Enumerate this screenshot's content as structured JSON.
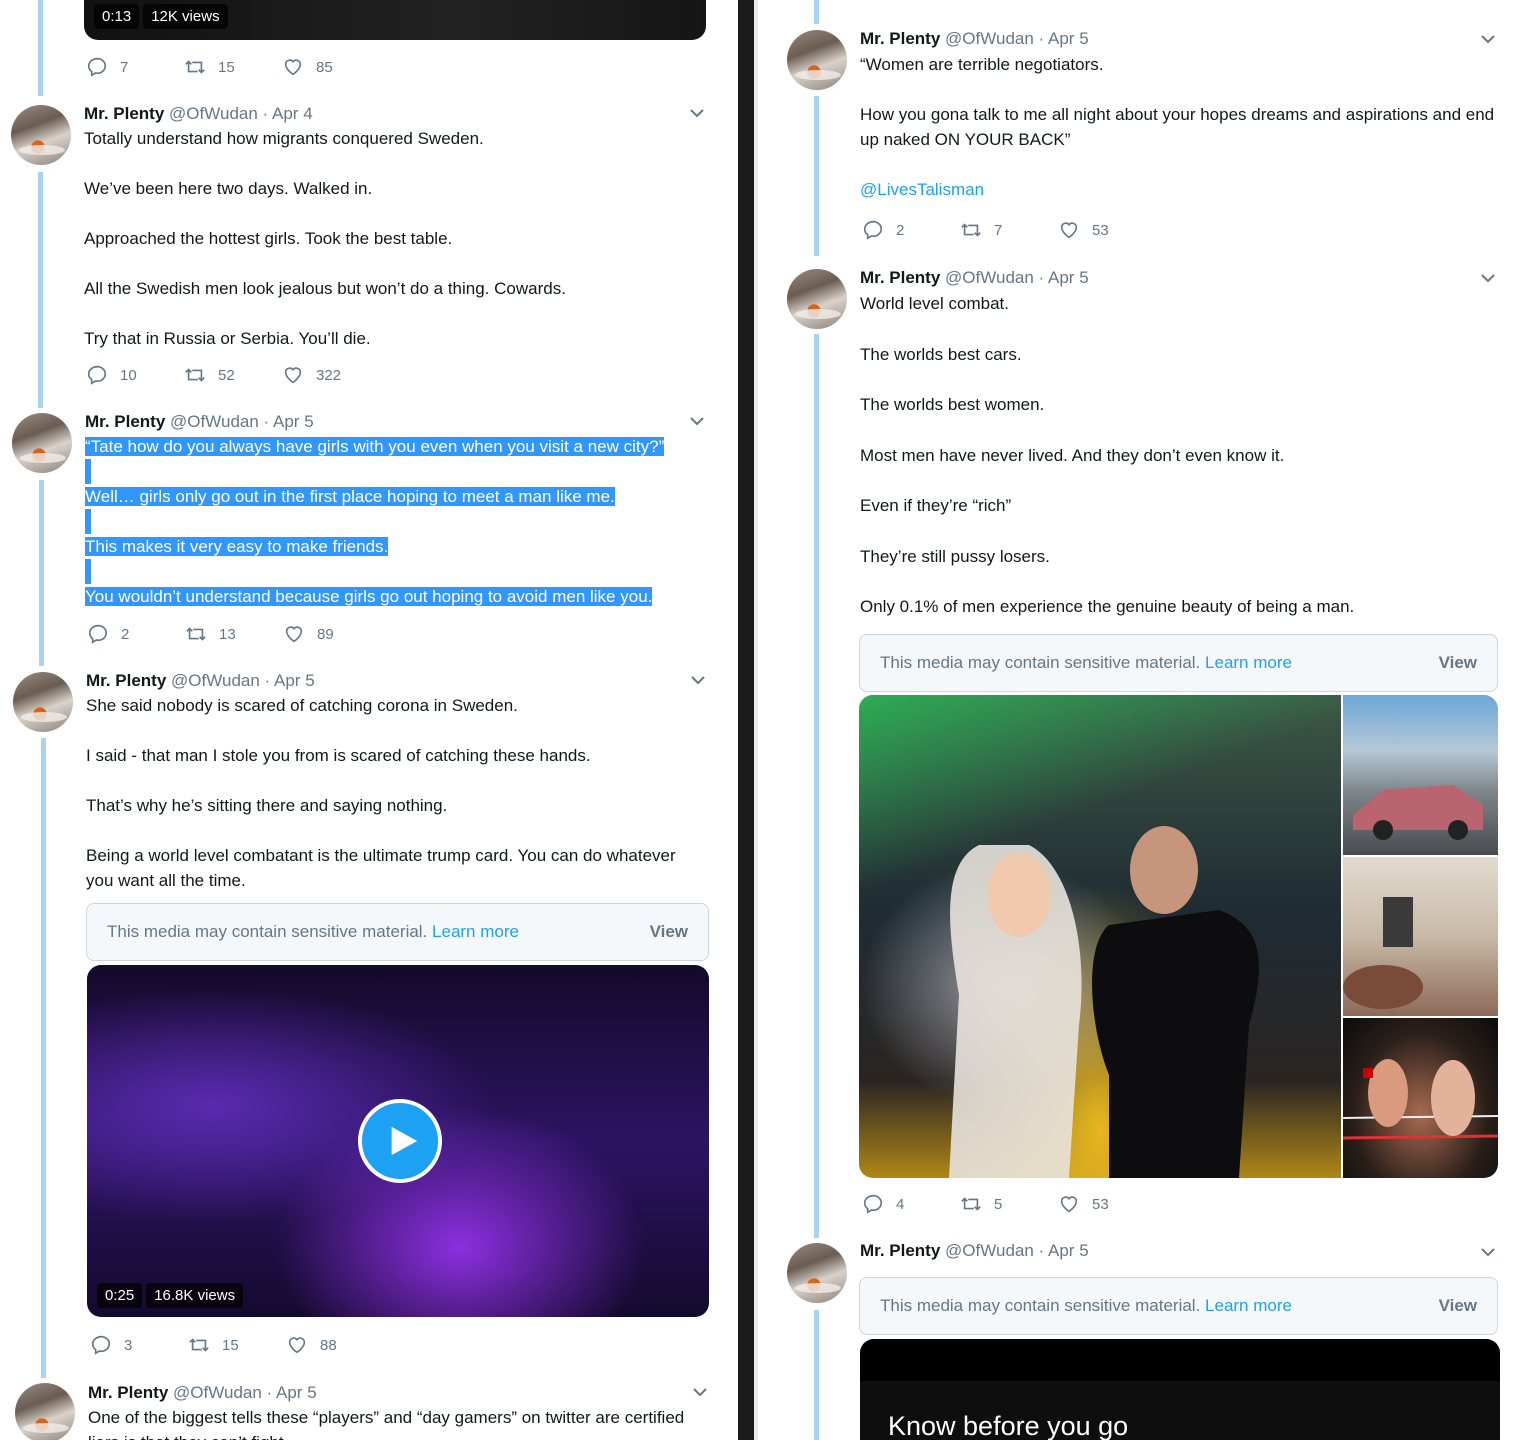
{
  "left": {
    "top_video": {
      "duration": "0:13",
      "views": "12K views"
    },
    "top_actions": {
      "replies": "7",
      "retweets": "15",
      "likes": "85"
    },
    "tweets": [
      {
        "name": "Mr. Plenty",
        "handle": "@OfWudan",
        "sep": "·",
        "date": "Apr 4",
        "lines": [
          "Totally understand how migrants conquered Sweden.",
          "We’ve been here two days. Walked in.",
          "Approached the hottest girls. Took the best table.",
          "All the Swedish men look jealous but won’t do a thing. Cowards.",
          "Try that in Russia or Serbia. You’ll die."
        ],
        "replies": "10",
        "retweets": "52",
        "likes": "322"
      },
      {
        "name": "Mr. Plenty",
        "handle": "@OfWudan",
        "sep": "·",
        "date": "Apr 5",
        "lines": [
          "“Tate how do you always have girls with you even when you visit a new city?”",
          "Well… girls only go out in the first place hoping to meet a man like me.",
          "This makes it very easy to make friends.",
          "You wouldn’t understand because girls go out hoping to avoid men like you."
        ],
        "replies": "2",
        "retweets": "13",
        "likes": "89"
      },
      {
        "name": "Mr. Plenty",
        "handle": "@OfWudan",
        "sep": "·",
        "date": "Apr 5",
        "lines": [
          "She said nobody is scared of catching corona in Sweden.",
          "I said - that man I stole you from is scared of catching these hands.",
          "That’s why he’s sitting there and saying nothing.",
          "Being a world level combatant is the ultimate trump card. You can do whatever you want all the time."
        ],
        "sensitive": {
          "text": "This media may contain sensitive material.",
          "learn": "Learn more",
          "view": "View"
        },
        "video": {
          "duration": "0:25",
          "views": "16.8K views"
        },
        "replies": "3",
        "retweets": "15",
        "likes": "88"
      },
      {
        "name": "Mr. Plenty",
        "handle": "@OfWudan",
        "sep": "·",
        "date": "Apr 5",
        "lines": [
          "One of the biggest tells these “players” and “day gamers” on twitter are certified liars is that they can’t fight"
        ]
      }
    ]
  },
  "right": {
    "tweets": [
      {
        "name": "Mr. Plenty",
        "handle": "@OfWudan",
        "sep": "·",
        "date": "Apr 5",
        "lines": [
          "“Women are terrible negotiators.",
          "How you gona talk to me all night about your hopes dreams and aspirations and end up naked ON YOUR BACK”",
          "@LivesTalisman"
        ],
        "replies": "2",
        "retweets": "7",
        "likes": "53"
      },
      {
        "name": "Mr. Plenty",
        "handle": "@OfWudan",
        "sep": "·",
        "date": "Apr 5",
        "lines": [
          "World level combat.",
          "The worlds best cars.",
          "The worlds best women.",
          "Most men have never lived. And they don’t even know it.",
          "Even if they’re “rich”",
          "They’re still pussy losers.",
          "Only 0.1% of men experience the genuine beauty of being a man."
        ],
        "sensitive": {
          "text": "This media may contain sensitive material.",
          "learn": "Learn more",
          "view": "View"
        },
        "replies": "4",
        "retweets": "5",
        "likes": "53"
      },
      {
        "name": "Mr. Plenty",
        "handle": "@OfWudan",
        "sep": "·",
        "date": "Apr 5",
        "sensitive": {
          "text": "This media may contain sensitive material.",
          "learn": "Learn more",
          "view": "View"
        },
        "media_title": "Know before you go"
      }
    ]
  },
  "icons": {
    "reply": "reply-icon",
    "retweet": "retweet-icon",
    "like": "heart-icon",
    "caret": "chevron-down-icon",
    "play": "play-icon"
  },
  "colors": {
    "link": "#1da1f2",
    "selection": "#3297fd",
    "thread_line": "#a8d3f5",
    "muted": "#657786"
  }
}
